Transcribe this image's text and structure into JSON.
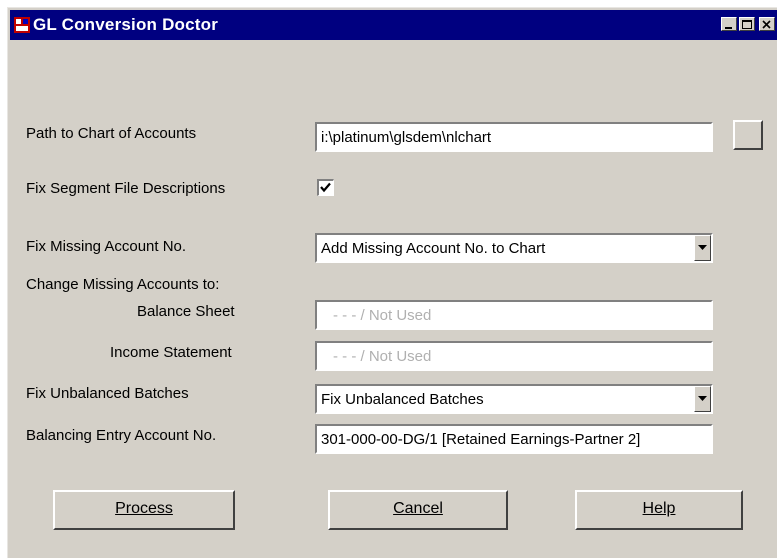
{
  "window": {
    "title": "GL Conversion Doctor"
  },
  "form": {
    "path_label": "Path to Chart of Accounts",
    "path_value": "i:\\platinum\\glsdem\\nlchart",
    "fix_segment_label": "Fix Segment File Descriptions",
    "fix_segment_checked": true,
    "fix_missing_label": "Fix Missing Account No.",
    "fix_missing_value": "Add Missing Account No. to Chart",
    "change_missing_label": "Change Missing Accounts to:",
    "balance_sheet_label": "Balance Sheet",
    "balance_sheet_value": "- - - / Not Used",
    "income_statement_label": "Income Statement",
    "income_statement_value": "- - - / Not Used",
    "fix_unbalanced_label": "Fix Unbalanced Batches",
    "fix_unbalanced_value": "Fix Unbalanced Batches",
    "balancing_entry_label": "Balancing Entry Account No.",
    "balancing_entry_value": "301-000-00-DG/1 [Retained Earnings-Partner 2]"
  },
  "buttons": {
    "process": "Process",
    "cancel": "Cancel",
    "help": "Help"
  },
  "colors": {
    "titlebar": "#000080",
    "face": "#d4d0c8",
    "disabled_text": "#b0b0b0"
  }
}
